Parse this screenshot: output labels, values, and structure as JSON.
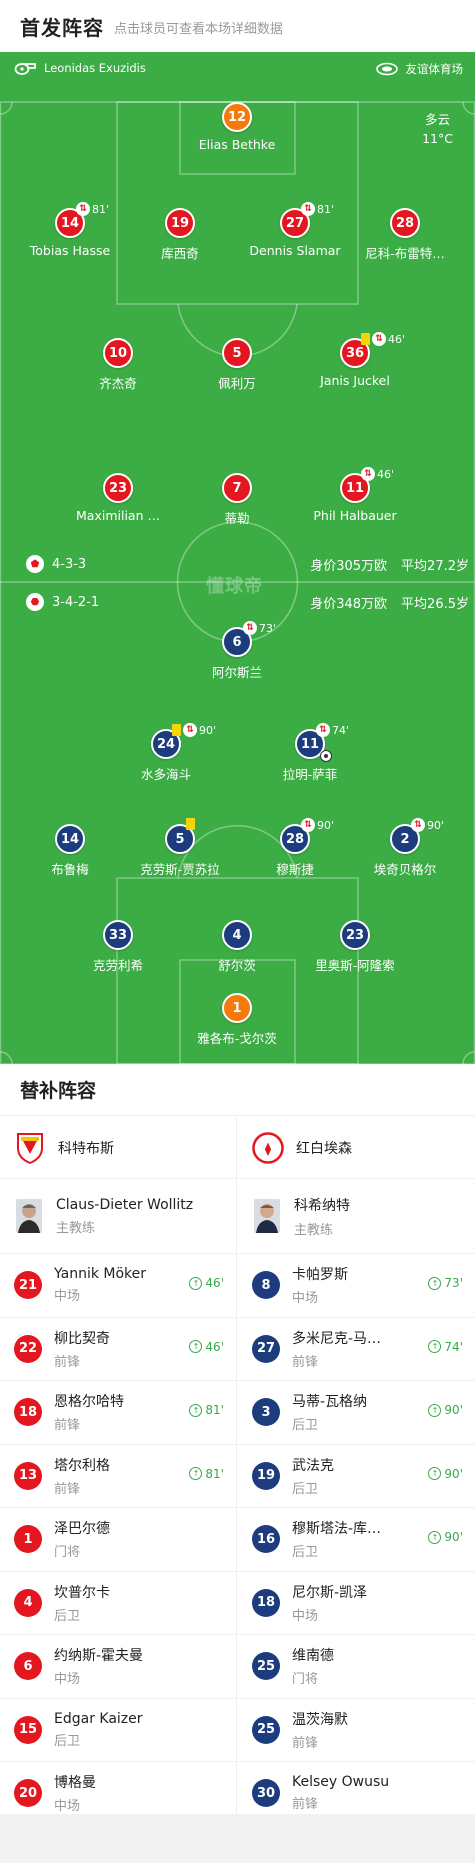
{
  "header": {
    "title": "首发阵容",
    "subtitle": "点击球员可查看本场详细数据"
  },
  "pitch": {
    "referee": "Leonidas Exuzidis",
    "stadium": "友谊体育场",
    "weather": "多云",
    "temp": "11°C",
    "watermark": "懂球帝",
    "home": {
      "formation": "4-3-3",
      "value": "身价305万欧",
      "age": "平均27.2岁"
    },
    "away": {
      "formation": "3-4-2-1",
      "value": "身价348万欧",
      "age": "平均26.5岁"
    }
  },
  "home_players": [
    {
      "n": "12",
      "name": "Elias Bethke",
      "kind": "gk"
    },
    {
      "n": "14",
      "name": "Tobias Hasse",
      "sub": "81'",
      "kind": "red"
    },
    {
      "n": "19",
      "name": "库西奇",
      "kind": "red"
    },
    {
      "n": "27",
      "name": "Dennis Slamar",
      "sub": "81'",
      "kind": "red"
    },
    {
      "n": "28",
      "name": "尼科-布雷特…",
      "kind": "red"
    },
    {
      "n": "10",
      "name": "齐杰奇",
      "kind": "red"
    },
    {
      "n": "5",
      "name": "佩利万",
      "kind": "red"
    },
    {
      "n": "36",
      "name": "Janis Juckel",
      "sub": "46'",
      "yellow": true,
      "kind": "red"
    },
    {
      "n": "23",
      "name": "Maximilian …",
      "kind": "red"
    },
    {
      "n": "7",
      "name": "蒂勒",
      "kind": "red"
    },
    {
      "n": "11",
      "name": "Phil Halbauer",
      "sub": "46'",
      "kind": "red"
    }
  ],
  "away_players": [
    {
      "n": "6",
      "name": "阿尔斯兰",
      "sub": "73'",
      "kind": "blue"
    },
    {
      "n": "24",
      "name": "水多海斗",
      "sub": "90'",
      "yellow": true,
      "kind": "blue"
    },
    {
      "n": "11",
      "name": "拉明-萨菲",
      "sub": "74'",
      "goal": true,
      "kind": "blue"
    },
    {
      "n": "14",
      "name": "布鲁梅",
      "kind": "blue"
    },
    {
      "n": "5",
      "name": "克劳斯-贾苏拉",
      "yellow_only": true,
      "kind": "blue"
    },
    {
      "n": "28",
      "name": "穆斯捷",
      "sub": "90'",
      "kind": "blue"
    },
    {
      "n": "2",
      "name": "埃奇贝格尔",
      "sub": "90'",
      "kind": "blue"
    },
    {
      "n": "33",
      "name": "克劳利希",
      "kind": "blue"
    },
    {
      "n": "4",
      "name": "舒尔茨",
      "kind": "blue"
    },
    {
      "n": "23",
      "name": "里奥斯-阿隆索",
      "kind": "blue"
    },
    {
      "n": "1",
      "name": "雅各布-戈尔茨",
      "kind": "gk"
    }
  ],
  "subs_title": "替补阵容",
  "home_team": {
    "name": "科特布斯",
    "coach": "Claus-Dieter Wollitz",
    "coach_role": "主教练",
    "colors": {
      "accent": "#e4161f"
    }
  },
  "away_team": {
    "name": "红白埃森",
    "coach": "科希纳特",
    "coach_role": "主教练",
    "colors": {
      "accent": "#e4161f"
    }
  },
  "home_subs": [
    {
      "n": "21",
      "name": "Yannik Möker",
      "pos": "中场",
      "time": "46'"
    },
    {
      "n": "22",
      "name": "柳比契奇",
      "pos": "前锋",
      "time": "46'"
    },
    {
      "n": "18",
      "name": "恩格尔哈特",
      "pos": "前锋",
      "time": "81'"
    },
    {
      "n": "13",
      "name": "塔尔利格",
      "pos": "前锋",
      "time": "81'"
    },
    {
      "n": "1",
      "name": "泽巴尔德",
      "pos": "门将"
    },
    {
      "n": "4",
      "name": "坎普尔卡",
      "pos": "后卫"
    },
    {
      "n": "6",
      "name": "约纳斯-霍夫曼",
      "pos": "中场"
    },
    {
      "n": "15",
      "name": "Edgar Kaizer",
      "pos": "后卫"
    },
    {
      "n": "20",
      "name": "博格曼",
      "pos": "中场"
    }
  ],
  "away_subs": [
    {
      "n": "8",
      "name": "卡帕罗斯",
      "pos": "中场",
      "time": "73'"
    },
    {
      "n": "27",
      "name": "多米尼克-马…",
      "pos": "前锋",
      "time": "74'"
    },
    {
      "n": "3",
      "name": "马蒂-瓦格纳",
      "pos": "后卫",
      "time": "90'"
    },
    {
      "n": "19",
      "name": "武法克",
      "pos": "后卫",
      "time": "90'"
    },
    {
      "n": "16",
      "name": "穆斯塔法-库…",
      "pos": "后卫",
      "time": "90'"
    },
    {
      "n": "18",
      "name": "尼尔斯-凯泽",
      "pos": "中场"
    },
    {
      "n": "25",
      "name": "维南德",
      "pos": "门将"
    },
    {
      "n": "25",
      "name": "温茨海默",
      "pos": "前锋"
    },
    {
      "n": "30",
      "name": "Kelsey Owusu",
      "pos": "前锋"
    }
  ]
}
